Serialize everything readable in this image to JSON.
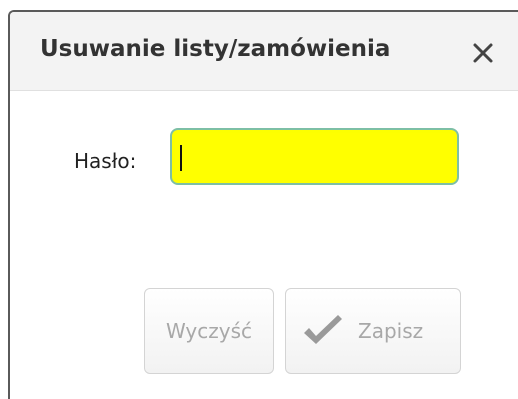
{
  "dialog": {
    "title": "Usuwanie listy/zamówienia",
    "close_icon": "close-icon"
  },
  "form": {
    "password_label": "Hasło:",
    "password_value": "",
    "password_placeholder": "",
    "field_bg_color": "#ffff00",
    "field_border_color": "#7dbfa5"
  },
  "buttons": {
    "clear_label": "Wyczyść",
    "save_label": "Zapisz",
    "save_icon": "checkmark-icon",
    "disabled_text_color": "#a8a8a8"
  }
}
